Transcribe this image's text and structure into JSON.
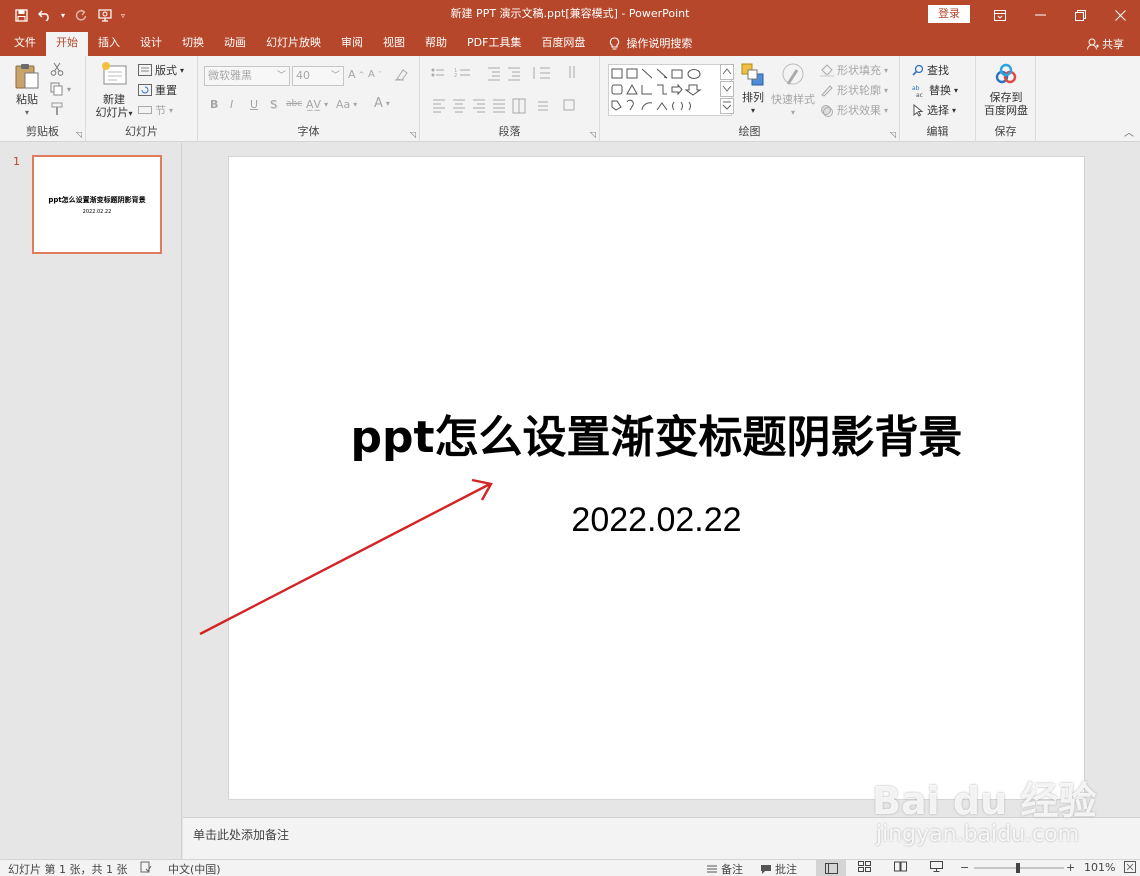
{
  "window": {
    "title": "新建 PPT 演示文稿.ppt[兼容模式] - PowerPoint",
    "login_label": "登录"
  },
  "tabs": [
    {
      "label": "文件"
    },
    {
      "label": "开始"
    },
    {
      "label": "插入"
    },
    {
      "label": "设计"
    },
    {
      "label": "切换"
    },
    {
      "label": "动画"
    },
    {
      "label": "幻灯片放映"
    },
    {
      "label": "审阅"
    },
    {
      "label": "视图"
    },
    {
      "label": "帮助"
    },
    {
      "label": "PDF工具集"
    },
    {
      "label": "百度网盘"
    }
  ],
  "tell_me": "操作说明搜索",
  "share_label": "共享",
  "ribbon": {
    "clipboard": {
      "label": "剪贴板",
      "paste": "粘贴"
    },
    "slides": {
      "label": "幻灯片",
      "new_slide_line1": "新建",
      "new_slide_line2": "幻灯片",
      "layout": "版式",
      "reset": "重置",
      "section": "节"
    },
    "font": {
      "label": "字体",
      "font_name": "微软雅黑",
      "font_size": "40"
    },
    "paragraph": {
      "label": "段落"
    },
    "drawing": {
      "label": "绘图",
      "arrange": "排列",
      "quick_styles": "快速样式",
      "shape_fill": "形状填充",
      "shape_outline": "形状轮廓",
      "shape_effects": "形状效果"
    },
    "editing": {
      "label": "编辑",
      "find": "查找",
      "replace": "替换",
      "select": "选择"
    },
    "save": {
      "label": "保存",
      "save_to_line1": "保存到",
      "save_to_line2": "百度网盘"
    }
  },
  "thumbnail": {
    "number": "1",
    "title": "ppt怎么设置渐变标题阴影背景",
    "date": "2022.02.22"
  },
  "slide": {
    "title": "ppt怎么设置渐变标题阴影背景",
    "subtitle": "2022.02.22"
  },
  "notes_placeholder": "单击此处添加备注",
  "statusbar": {
    "slide_info": "幻灯片 第 1 张，共 1 张",
    "language": "中文(中国)",
    "notes": "备注",
    "comments": "批注",
    "zoom": "101%"
  },
  "watermark": {
    "brand": "Bai du 经验",
    "url": "jingyan.baidu.com"
  },
  "colors": {
    "accent": "#b7472a",
    "arrow": "#d42424"
  }
}
